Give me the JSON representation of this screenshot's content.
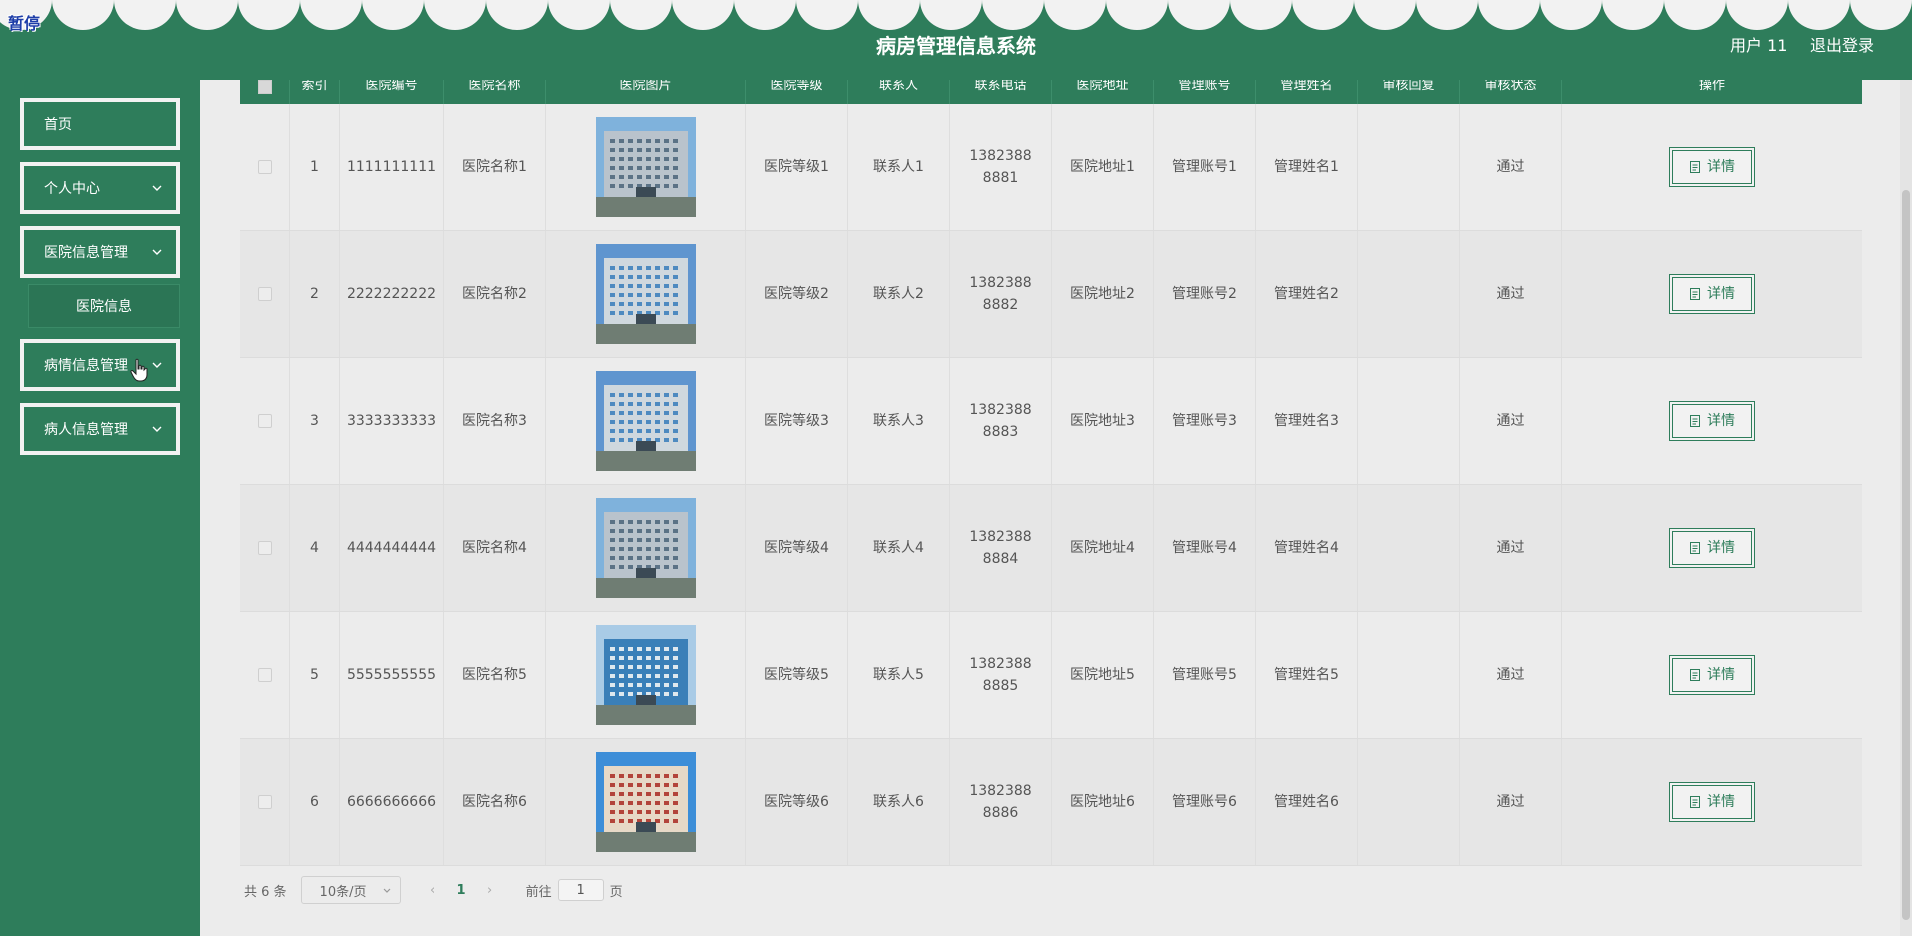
{
  "header": {
    "pause_label": "暂停",
    "title": "病房管理信息系统",
    "user": "用户 11",
    "logout": "退出登录",
    "brand_color": "#2e7d5b"
  },
  "sidebar": {
    "items": [
      {
        "label": "首页"
      },
      {
        "label": "个人中心"
      },
      {
        "label": "医院信息管理"
      },
      {
        "label": "病情信息管理"
      },
      {
        "label": "病人信息管理"
      }
    ],
    "submenu": {
      "label": "医院信息"
    }
  },
  "table": {
    "columns": [
      "索引",
      "医院编号",
      "医院名称",
      "医院图片",
      "医院等级",
      "联系人",
      "联系电话",
      "医院地址",
      "管理账号",
      "管理姓名",
      "审核回复",
      "审核状态",
      "操作"
    ],
    "rows": [
      {
        "index": "1",
        "code": "1111111111",
        "name": "医院名称1",
        "level": "医院等级1",
        "contact": "联系人1",
        "phone": "13823888881",
        "address": "医院地址1",
        "account": "管理账号1",
        "manager": "管理姓名1",
        "reply": "",
        "status": "通过",
        "action": "详情"
      },
      {
        "index": "2",
        "code": "2222222222",
        "name": "医院名称2",
        "level": "医院等级2",
        "contact": "联系人2",
        "phone": "13823888882",
        "address": "医院地址2",
        "account": "管理账号2",
        "manager": "管理姓名2",
        "reply": "",
        "status": "通过",
        "action": "详情"
      },
      {
        "index": "3",
        "code": "3333333333",
        "name": "医院名称3",
        "level": "医院等级3",
        "contact": "联系人3",
        "phone": "13823888883",
        "address": "医院地址3",
        "account": "管理账号3",
        "manager": "管理姓名3",
        "reply": "",
        "status": "通过",
        "action": "详情"
      },
      {
        "index": "4",
        "code": "4444444444",
        "name": "医院名称4",
        "level": "医院等级4",
        "contact": "联系人4",
        "phone": "13823888884",
        "address": "医院地址4",
        "account": "管理账号4",
        "manager": "管理姓名4",
        "reply": "",
        "status": "通过",
        "action": "详情"
      },
      {
        "index": "5",
        "code": "5555555555",
        "name": "医院名称5",
        "level": "医院等级5",
        "contact": "联系人5",
        "phone": "13823888885",
        "address": "医院地址5",
        "account": "管理账号5",
        "manager": "管理姓名5",
        "reply": "",
        "status": "通过",
        "action": "详情"
      },
      {
        "index": "6",
        "code": "6666666666",
        "name": "医院名称6",
        "level": "医院等级6",
        "contact": "联系人6",
        "phone": "13823888886",
        "address": "医院地址6",
        "account": "管理账号6",
        "manager": "管理姓名6",
        "reply": "",
        "status": "通过",
        "action": "详情"
      }
    ]
  },
  "pagination": {
    "total": "共 6 条",
    "page_size": "10条/页",
    "current_page": "1",
    "goto_label": "前往",
    "goto_value": "1",
    "goto_unit": "页"
  }
}
